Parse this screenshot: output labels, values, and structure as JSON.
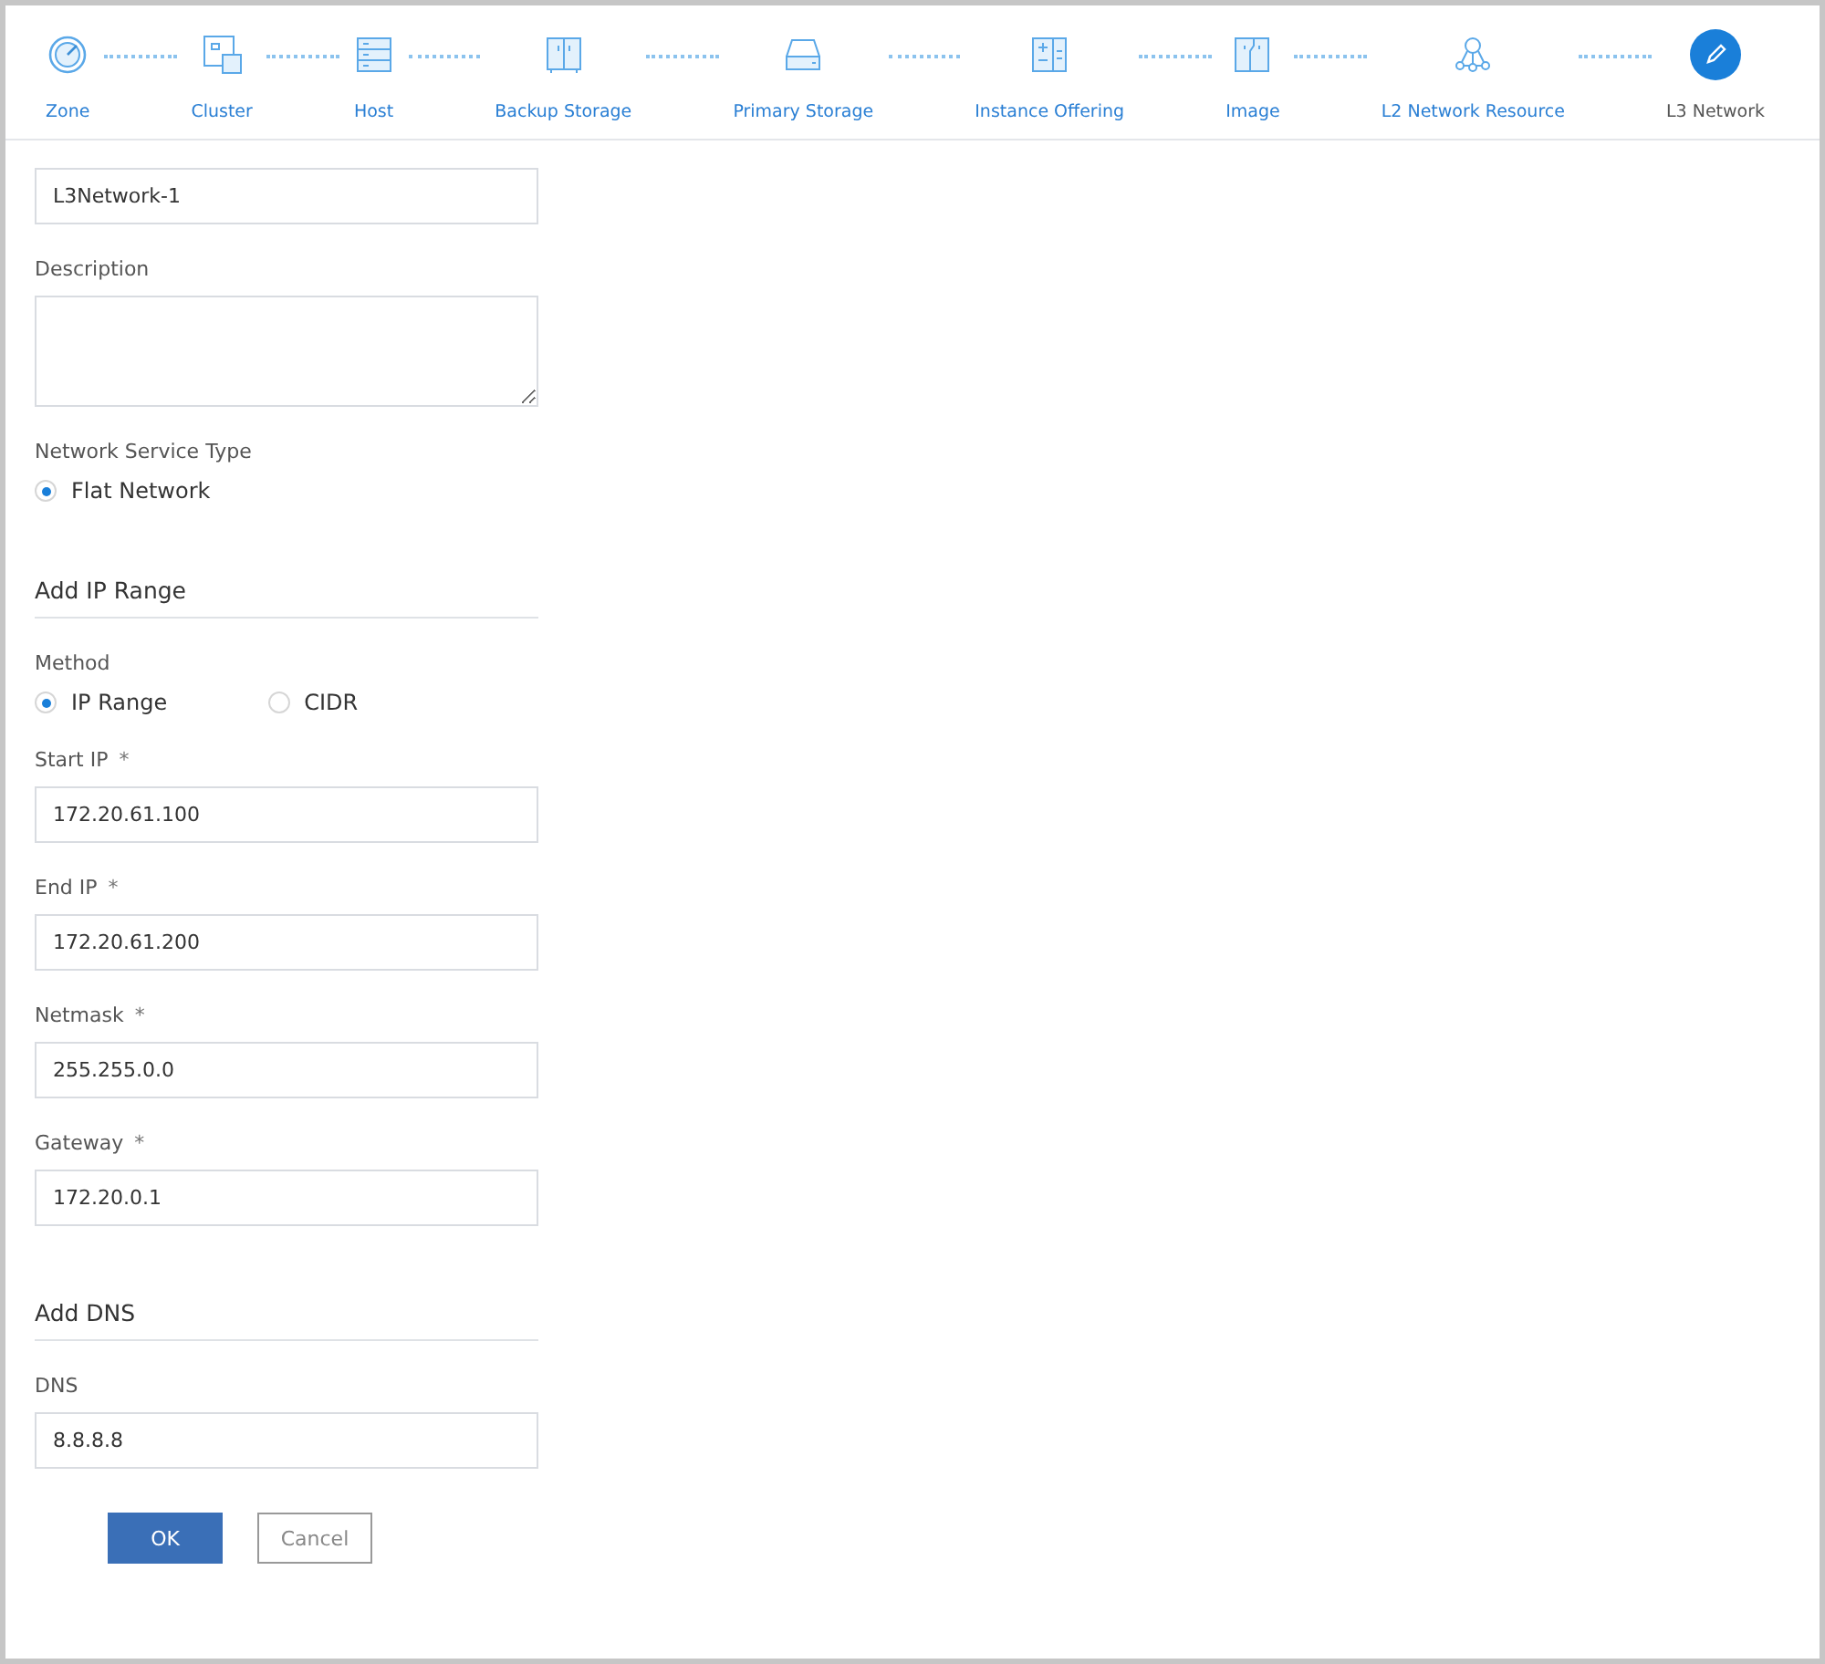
{
  "steps": [
    {
      "label": "Zone",
      "selected": false
    },
    {
      "label": "Cluster",
      "selected": false
    },
    {
      "label": "Host",
      "selected": false
    },
    {
      "label": "Backup Storage",
      "selected": false
    },
    {
      "label": "Primary Storage",
      "selected": false
    },
    {
      "label": "Instance Offering",
      "selected": false
    },
    {
      "label": "Image",
      "selected": false
    },
    {
      "label": "L2 Network Resource",
      "selected": false
    },
    {
      "label": "L3 Network",
      "selected": true
    }
  ],
  "form": [
    {
      "kind": "input",
      "value": "L3Network-1"
    },
    {
      "kind": "textarea",
      "label": "Description"
    },
    {
      "kind": "radios",
      "label": "Network Service Type",
      "options": [
        {
          "label": "Flat Network",
          "selected": true
        }
      ]
    },
    {
      "kind": "section",
      "title": "Add IP Range"
    },
    {
      "kind": "radios",
      "label": "Method",
      "options": [
        {
          "label": "IP Range",
          "selected": true
        },
        {
          "label": "CIDR",
          "selected": false
        }
      ]
    },
    {
      "kind": "input",
      "label": "Start IP",
      "required_mark": "*",
      "value": "172.20.61.100"
    },
    {
      "kind": "input",
      "label": "End IP",
      "required_mark": "*",
      "value": "172.20.61.200"
    },
    {
      "kind": "input",
      "label": "Netmask",
      "required_mark": "*",
      "value": "255.255.0.0"
    },
    {
      "kind": "input",
      "label": "Gateway",
      "required_mark": "*",
      "value": "172.20.0.1"
    },
    {
      "kind": "section",
      "title": "Add DNS"
    },
    {
      "kind": "input",
      "label": "DNS",
      "value": "8.8.8.8"
    }
  ],
  "buttons": [
    {
      "label": "OK",
      "kind": "primary"
    },
    {
      "label": "Cancel",
      "kind": "secondary"
    }
  ]
}
